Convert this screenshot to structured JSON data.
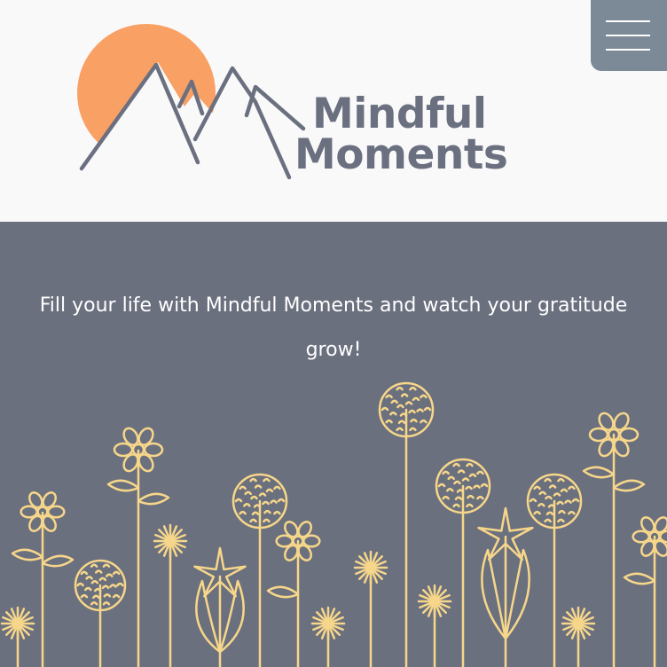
{
  "brand": {
    "line1": "Mindful",
    "line2": "Moments",
    "colors": {
      "sun": "#f9a064",
      "mountains": "#6b7080",
      "text": "#6b7080"
    }
  },
  "menu": {
    "icon": "hamburger-menu-icon",
    "color": "#7c8a98"
  },
  "hero": {
    "tagline": "Fill your life with Mindful Moments and watch your gratitude grow!",
    "background": "#6b707e",
    "flower_color": "#f6d68a"
  }
}
